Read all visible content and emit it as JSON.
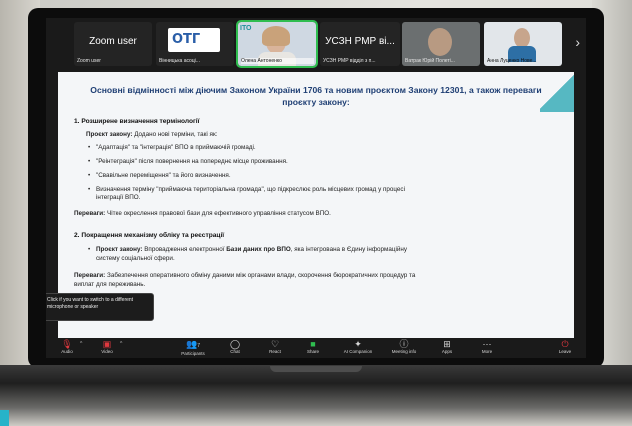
{
  "participants": [
    {
      "big": "Zoom user",
      "name": "Zoom user"
    },
    {
      "name": "Вінницька асоці..."
    },
    {
      "name": "Олена Антоненко"
    },
    {
      "big": "УСЗН РМР ві...",
      "name": "УСЗН РМР відділ з п..."
    },
    {
      "name": "Ватрак Юрій Полеті..."
    },
    {
      "name": "Анна Луценко Нове..."
    }
  ],
  "slide": {
    "title": "Основні відмінності між діючим Законом України 1706 та новим проєктом Закону 12301, а також переваги проєкту закону:",
    "s1_heading": "1. Розширене визначення термінології",
    "s1_lead_bold": "Проєкт закону:",
    "s1_lead": " Додано нові терміни, такі як:",
    "s1_b1": "\"Адаптація\" та \"інтеграція\" ВПО в приймаючій громаді.",
    "s1_b2": "\"Реінтеграція\" після повернення на попереднє місце проживання.",
    "s1_b3": "\"Свавільне переміщення\" та його визначення.",
    "s1_b4a": "Визначення терміну \"приймаюча територіальна громада\", що підкреслює роль місцевих громад у процесі",
    "s1_b4b": "інтеграції ВПО.",
    "s1_adv_bold": "Переваги:",
    "s1_adv": " Чітке окреслення правової бази для ефективного управління статусом ВПО.",
    "s2_heading": "2. Покращення механізму обліку та реєстрації",
    "s2_lead_bold": "Проєкт закону:",
    "s2_lead_a": " Впровадження електронної ",
    "s2_lead_bold2": "Бази даних про ВПО",
    "s2_lead_b": ", яка інтегрована в Єдину інформаційну",
    "s2_lead_c": "систему соціальної сфери.",
    "s2_adv_bold": "Переваги:",
    "s2_adv_a": " Забезпечення оперативного обміну даними між органами влади, скорочення бюрократичних процедур та",
    "s2_adv_b": "виплат для переживань."
  },
  "tooltip": "Click if you want to switch to a different microphone or speaker",
  "toolbar": {
    "audio": "Audio",
    "video": "Video",
    "participants": "Participants",
    "participants_count": "7",
    "chat": "Chat",
    "react": "React",
    "share": "Share",
    "ai": "AI Companion",
    "info": "Meeting info",
    "apps": "Apps",
    "more": "More",
    "leave": "Leave"
  },
  "colors": {
    "share_green": "#2fbd4f",
    "leave_red": "#e0383e",
    "title_blue": "#1f3f74",
    "accent": "#27b3c9"
  }
}
